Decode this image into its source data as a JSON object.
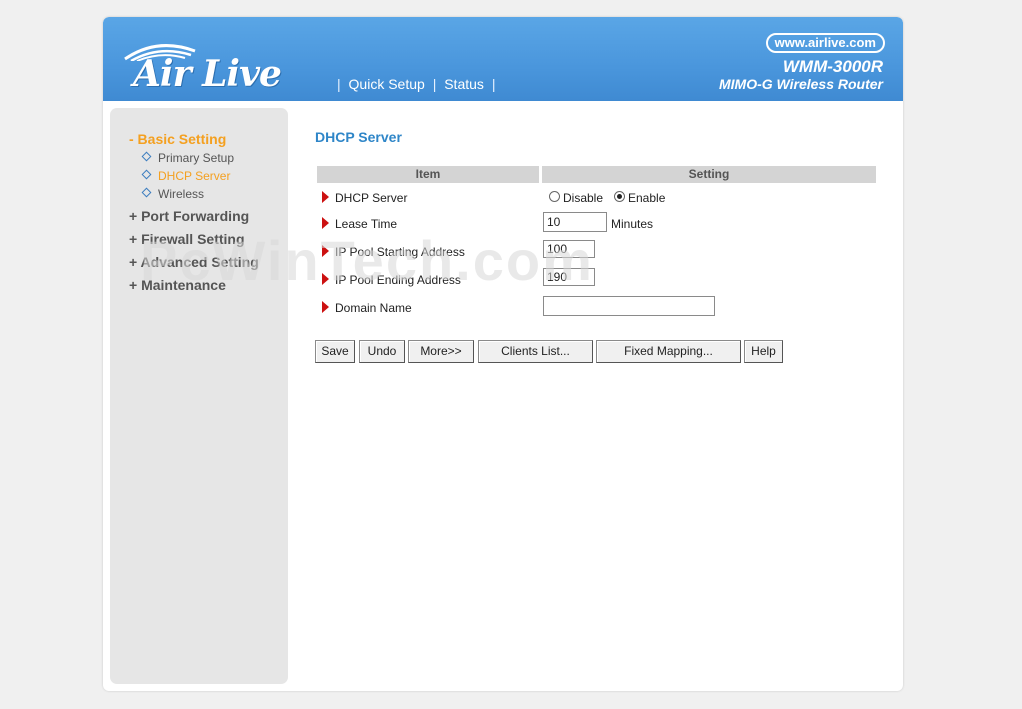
{
  "header": {
    "brand": "Air Live",
    "url": "www.airlive.com",
    "model": "WMM-3000R",
    "model_subtitle": "MIMO-G Wireless Router",
    "nav": [
      {
        "label": "Quick Setup"
      },
      {
        "label": "Status"
      }
    ],
    "separator": "|"
  },
  "sidebar": {
    "groups": [
      {
        "label": "- Basic Setting",
        "active": true,
        "items": [
          {
            "label": "Primary Setup",
            "active": false
          },
          {
            "label": "DHCP Server",
            "active": true
          },
          {
            "label": "Wireless",
            "active": false
          }
        ]
      },
      {
        "label": "+ Port Forwarding"
      },
      {
        "label": "+ Firewall Setting"
      },
      {
        "label": "+ Advanced Setting"
      },
      {
        "label": "+ Maintenance"
      }
    ]
  },
  "watermark": "PcWinTech.com",
  "main": {
    "title": "DHCP Server",
    "table": {
      "col_item": "Item",
      "col_setting": "Setting",
      "rows": [
        {
          "label": "DHCP Server"
        },
        {
          "label": "Lease Time"
        },
        {
          "label": "IP Pool Starting Address"
        },
        {
          "label": "IP Pool Ending Address"
        },
        {
          "label": "Domain Name"
        }
      ]
    },
    "dhcp": {
      "options": [
        "Disable",
        "Enable"
      ],
      "selected": "Enable"
    },
    "lease_time": {
      "value": "10",
      "unit": "Minutes"
    },
    "pool_start": {
      "value": "100"
    },
    "pool_end": {
      "value": "190"
    },
    "domain_name": {
      "value": ""
    },
    "buttons": {
      "save": "Save",
      "undo": "Undo",
      "more": "More>>",
      "clients": "Clients List...",
      "fixed": "Fixed Mapping...",
      "help": "Help"
    }
  },
  "colors": {
    "header_blue": "#4a96dc",
    "active_orange": "#f4a020",
    "title_blue": "#2f86c8",
    "arrow_red": "#cc1111"
  }
}
